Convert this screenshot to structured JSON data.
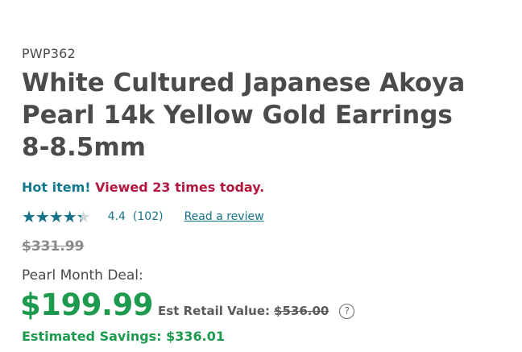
{
  "product": {
    "sku": "PWP362",
    "title": "White Cultured Japanese Akoya Pearl 14k Yellow Gold Earrings 8-8.5mm"
  },
  "popularity": {
    "lead": "Hot item!",
    "views": "Viewed 23 times today."
  },
  "rating": {
    "stars_glyphs": "★★★★★",
    "score": "4.4",
    "score_value": 4.4,
    "max": 5,
    "count": "(102)",
    "review_link": "Read a review",
    "star_color": "#16738a"
  },
  "pricing": {
    "original_price": "$331.99",
    "deal_label": "Pearl Month Deal:",
    "price": "$199.99",
    "retail_label": "Est Retail Value:",
    "retail_value": "$536.00",
    "help_icon_glyph": "?",
    "savings": "Estimated Savings: $336.01",
    "price_color": "#1d9a4d"
  },
  "icons": {
    "help": "question-circle-icon",
    "rating": "star-icon"
  }
}
